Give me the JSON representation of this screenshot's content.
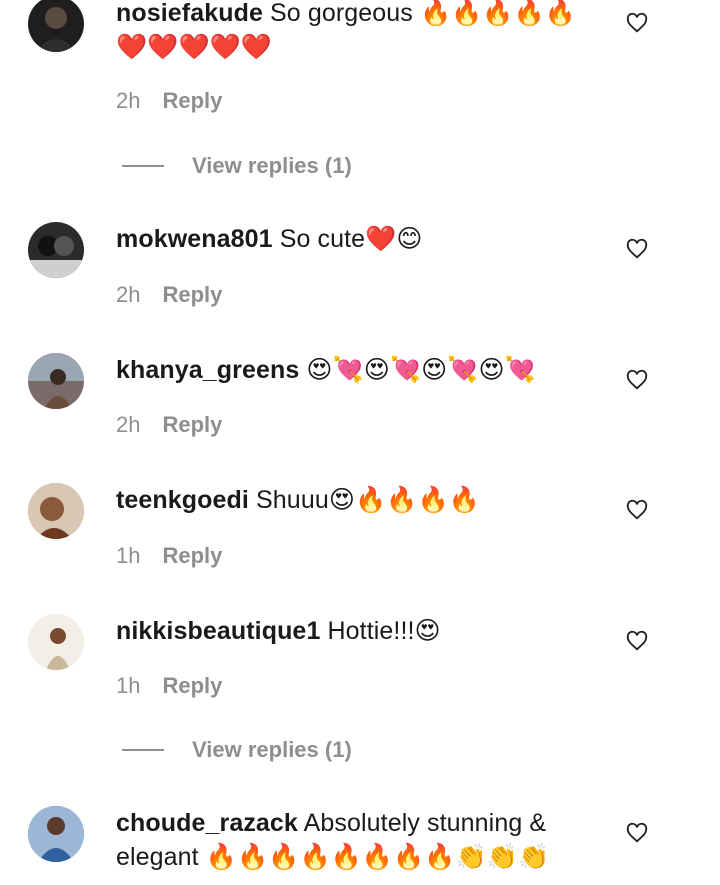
{
  "comments": [
    {
      "username": "nosiefakude",
      "text": "So gorgeous 🔥🔥🔥🔥🔥❤️❤️❤️❤️❤️",
      "time": "2h",
      "reply_label": "Reply",
      "avatar_color": "#1e1e1e",
      "view_replies": "View replies (1)"
    },
    {
      "username": "mokwena801",
      "text": "So cute❤️😊",
      "time": "2h",
      "reply_label": "Reply",
      "avatar_color": "#2b2b2b"
    },
    {
      "username": "khanya_greens",
      "text": "😍💘😍💘😍💘😍💘",
      "time": "2h",
      "reply_label": "Reply",
      "avatar_color": "#7a6a6a"
    },
    {
      "username": "teenkgoedi",
      "text": "Shuuu😍🔥🔥🔥🔥",
      "time": "1h",
      "reply_label": "Reply",
      "avatar_color": "#b58a6a"
    },
    {
      "username": "nikkisbeautique1",
      "text": "Hottie!!!😍",
      "time": "1h",
      "reply_label": "Reply",
      "avatar_color": "#e8e2d8",
      "view_replies": "View replies (1)"
    },
    {
      "username": "choude_razack",
      "text": "Absolutely stunning & elegant 🔥🔥🔥🔥🔥🔥🔥🔥👏👏👏",
      "avatar_color": "#3b6fb0"
    }
  ],
  "icons": {
    "like": "heart-outline-icon"
  }
}
